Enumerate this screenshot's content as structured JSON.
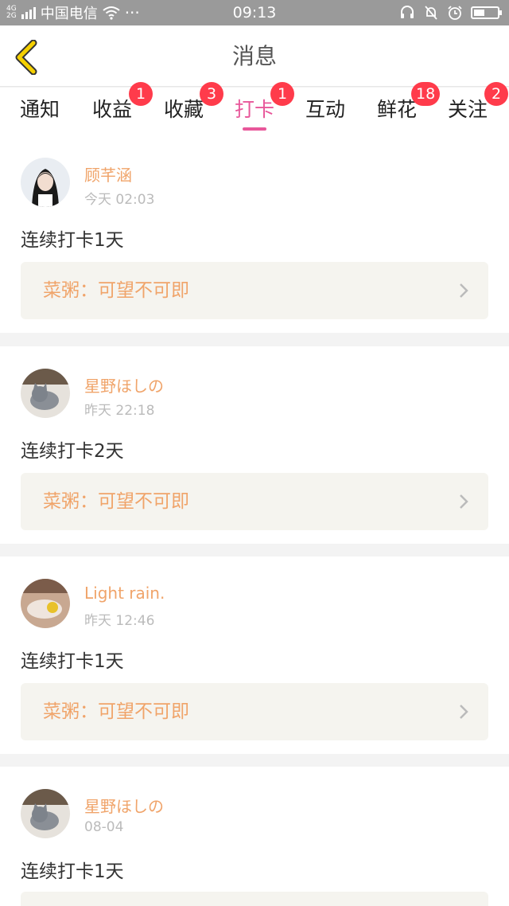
{
  "status_bar": {
    "network_top": "4G",
    "network_bottom": "2G",
    "carrier": "中国电信",
    "dots": "···",
    "time": "09:13",
    "battery_level": 0.45,
    "icons": [
      "wifi-icon",
      "headset-icon",
      "mute-bell-icon",
      "alarm-icon",
      "battery-icon"
    ]
  },
  "header": {
    "title": "消息",
    "back_icon": "chevron-left-icon",
    "accent_color": "#f5d000"
  },
  "tabs": [
    {
      "label": "通知",
      "badge": ""
    },
    {
      "label": "收益",
      "badge": "1"
    },
    {
      "label": "收藏",
      "badge": "3"
    },
    {
      "label": "打卡",
      "badge": "1",
      "active": true
    },
    {
      "label": "互动",
      "badge": ""
    },
    {
      "label": "鲜花",
      "badge": "18"
    },
    {
      "label": "关注",
      "badge": "2"
    }
  ],
  "colors": {
    "active_tab": "#e8579a",
    "badge": "#ff3b4b",
    "username": "#f0a46a",
    "link_box_bg": "#f5f4ef"
  },
  "messages": [
    {
      "name": "顾芊涵",
      "time": "今天 02:03",
      "text": "连续打卡1天",
      "link": "菜粥：可望不可即",
      "avatar_icon": "avatar-girl"
    },
    {
      "name": "星野ほしの",
      "time": "昨天 22:18",
      "text": "连续打卡2天",
      "link": "菜粥：可望不可即",
      "avatar_icon": "avatar-cat"
    },
    {
      "name": "Light rain.",
      "time": "昨天 12:46",
      "text": "连续打卡1天",
      "link": "菜粥：可望不可即",
      "avatar_icon": "avatar-food"
    },
    {
      "name": "星野ほしの",
      "time": "08-04",
      "text": "连续打卡1天",
      "link": "",
      "avatar_icon": "avatar-cat"
    }
  ]
}
